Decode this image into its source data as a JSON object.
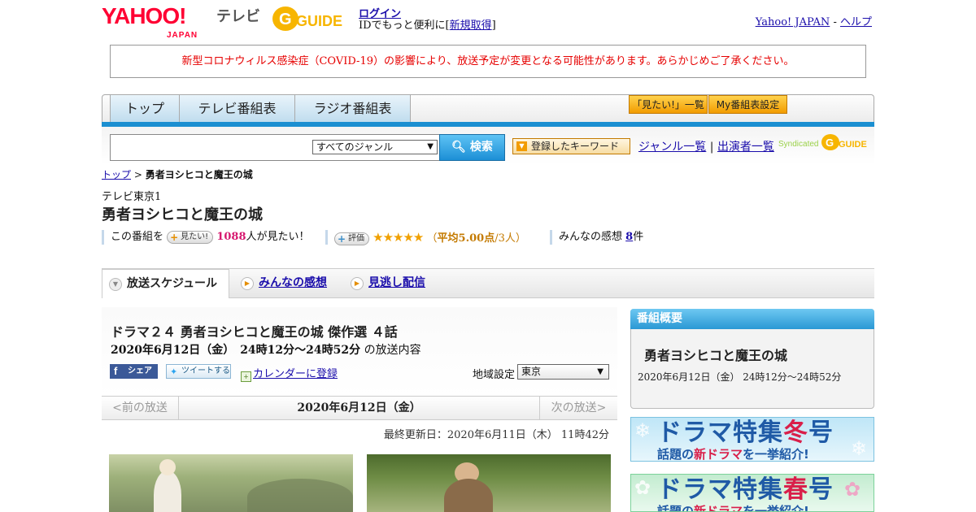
{
  "header": {
    "yahoo_logo": "YAHOO!",
    "yahoo_logo_sub": "JAPAN",
    "tv_label": "テレビ",
    "gguide_logo": "GUIDE",
    "login_label": "ログイン",
    "login_sub_prefix": "IDでもっと便利に[",
    "signup_label": "新規取得",
    "login_sub_suffix": "]",
    "yahoo_japan_link": "Yahoo! JAPAN",
    "separator": " - ",
    "help_link": "ヘルプ"
  },
  "notice": "新型コロナウィルス感染症（COVID-19）の影響により、放送予定が変更となる可能性があります。あらかじめご了承ください。",
  "nav": {
    "tabs": [
      "トップ",
      "テレビ番組表",
      "ラジオ番組表"
    ],
    "want_list": "「見たい!」一覧",
    "my_schedule": "My番組表設定"
  },
  "search": {
    "genre_selected": "すべてのジャンル",
    "button": "検索",
    "keyword_button": "登録したキーワード",
    "genre_list_link": "ジャンル一覧",
    "divider": "|",
    "cast_list_link": "出演者一覧",
    "syndicated": "Syndicated"
  },
  "breadcrumb": {
    "top": "トップ",
    "sep": " > ",
    "current": "勇者ヨシヒコと魔王の城"
  },
  "program": {
    "channel": "テレビ東京1",
    "title": "勇者ヨシヒコと魔王の城",
    "want_prefix": "この番組を",
    "want_button": "見たい!",
    "want_count": "1088",
    "want_suffix": "人が見たい！",
    "rate_button": "評価",
    "stars": "★★★★★",
    "avg_open": "（",
    "avg_label": "平均5.00点",
    "avg_count": "/3人）",
    "reviews_prefix": "みんなの感想",
    "reviews_count": "8",
    "reviews_suffix": "件",
    "rating_value": 5.0
  },
  "tabs": {
    "schedule": "放送スケジュール",
    "reviews": "みんなの感想",
    "vod": "見逃し配信"
  },
  "episode": {
    "title": "ドラマ２４ 勇者ヨシヒコと魔王の城 傑作選 ４話",
    "datetime": "2020年6月12日（金）　24時12分～24時52分",
    "datetime_suffix": "の放送内容",
    "share_facebook": "シェア",
    "share_twitter": "ツイートする",
    "calendar": "カレンダーに登録",
    "region_label": "地域設定",
    "region_selected": "東京"
  },
  "pager": {
    "prev": "<前の放送",
    "current": "2020年6月12日（金）",
    "next": "次の放送>"
  },
  "updated": "最終更新日：2020年6月11日（木） 11時42分",
  "sidebar": {
    "header": "番組概要",
    "title": "勇者ヨシヒコと魔王の城",
    "date": "2020年6月12日（金） 24時12分～24時52分",
    "banner_winter_main": "ドラマ特集",
    "banner_winter_season": "冬",
    "banner_winter_suffix": "号",
    "banner_sub_a": "話題の",
    "banner_sub_hl": "新ドラマ",
    "banner_sub_b": "を一挙紹介!",
    "banner_spring_main": "ドラマ特集",
    "banner_spring_season": "春",
    "banner_spring_suffix": "号"
  },
  "colors": {
    "brand_red": "#ff0033",
    "nav_blue": "#1b8fd1",
    "notice_red": "#e60000",
    "accent_orange": "#f29c00",
    "want_pink": "#d6186f"
  }
}
